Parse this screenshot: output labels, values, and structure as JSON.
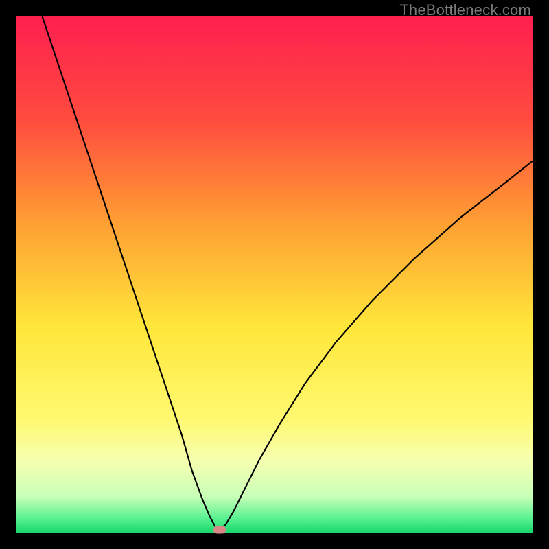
{
  "watermark": "TheBottleneck.com",
  "chart_data": {
    "type": "line",
    "title": "",
    "xlabel": "",
    "ylabel": "",
    "xlim": [
      0,
      100
    ],
    "ylim": [
      0,
      100
    ],
    "grid": false,
    "legend": false,
    "background_gradient": {
      "stops": [
        {
          "pos": 0.0,
          "color": "#ff1f4f"
        },
        {
          "pos": 0.2,
          "color": "#ff4b3f"
        },
        {
          "pos": 0.4,
          "color": "#ff9f33"
        },
        {
          "pos": 0.6,
          "color": "#ffe63a"
        },
        {
          "pos": 0.78,
          "color": "#fff970"
        },
        {
          "pos": 0.86,
          "color": "#f6ffb0"
        },
        {
          "pos": 0.93,
          "color": "#c8ffb8"
        },
        {
          "pos": 0.975,
          "color": "#53f08e"
        },
        {
          "pos": 1.0,
          "color": "#18d86a"
        }
      ]
    },
    "series": [
      {
        "name": "bottleneck-curve",
        "color": "#000000",
        "x": [
          5,
          8,
          11,
          14,
          17,
          20,
          23,
          26,
          29,
          32,
          34,
          36,
          37.5,
          38.5,
          39.3,
          40.5,
          42,
          44,
          47,
          51,
          56,
          62,
          69,
          77,
          86,
          95,
          100
        ],
        "y": [
          100,
          91,
          82,
          73,
          64,
          55,
          46,
          37,
          28,
          19,
          12,
          6.5,
          3,
          1.2,
          0.6,
          1.5,
          4,
          8,
          14,
          21,
          29,
          37,
          45,
          53,
          61,
          68,
          72
        ]
      }
    ],
    "marker": {
      "x": 39.3,
      "y": 0.5,
      "color": "#d98888"
    },
    "annotations": []
  }
}
